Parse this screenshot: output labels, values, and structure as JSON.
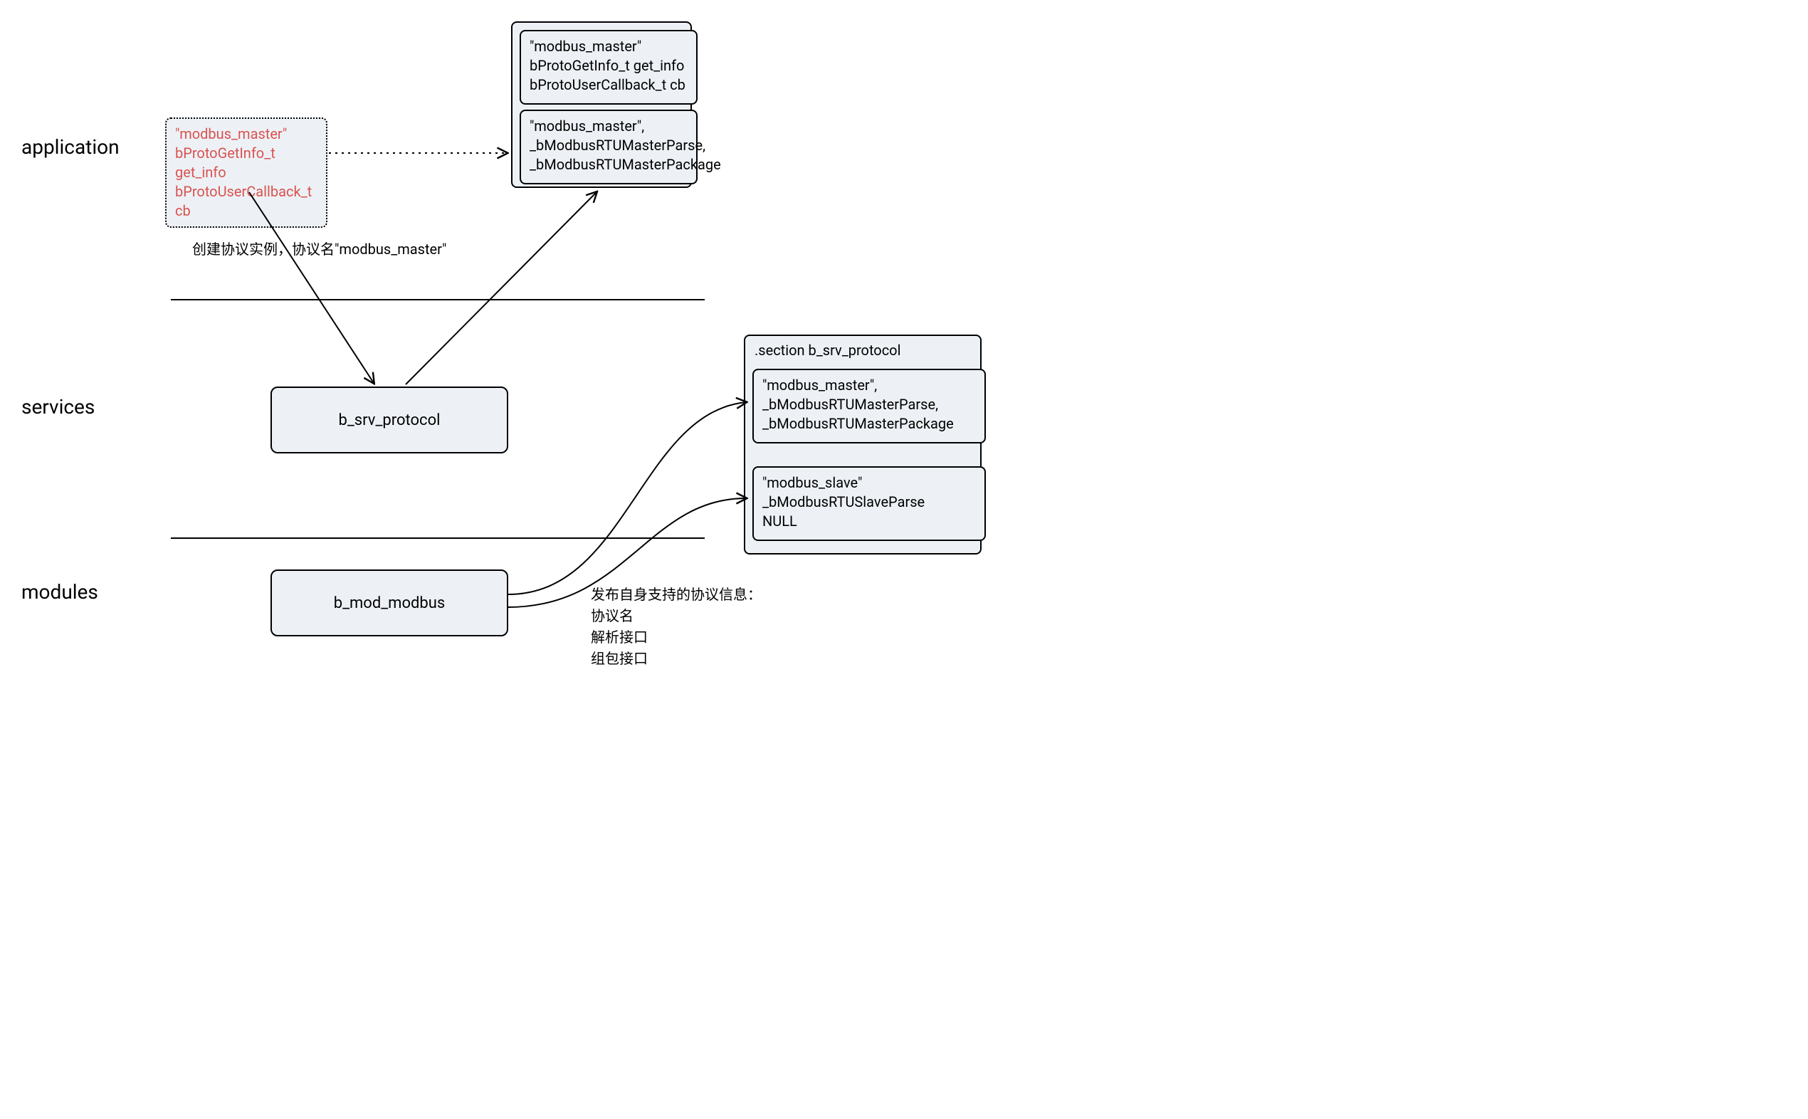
{
  "layers": {
    "application": "application",
    "services": "services",
    "modules": "modules"
  },
  "boxes": {
    "srv": "b_srv_protocol",
    "modbus": "b_mod_modbus"
  },
  "dashedBox": {
    "l1": "\"modbus_master\"",
    "l2": "bProtoGetInfo_t get_info",
    "l3": "bProtoUserCallback_t cb"
  },
  "topPanel": {
    "inner1": {
      "l1": "\"modbus_master\"",
      "l2": "bProtoGetInfo_t get_info",
      "l3": "bProtoUserCallback_t cb"
    },
    "inner2": {
      "l1": "\"modbus_master\",",
      "l2": "_bModbusRTUMasterParse,",
      "l3": "_bModbusRTUMasterPackage"
    }
  },
  "rightPanel": {
    "title": ".section b_srv_protocol",
    "inner1": {
      "l1": "\"modbus_master\",",
      "l2": "_bModbusRTUMasterParse,",
      "l3": "_bModbusRTUMasterPackage"
    },
    "inner2": {
      "l1": "\"modbus_slave\"",
      "l2": "_bModbusRTUSlaveParse",
      "l3": "NULL"
    }
  },
  "notes": {
    "create": "创建协议实例，协议名\"modbus_master\"",
    "publish": "发布自身支持的协议信息：\n协议名\n解析接口\n组包接口"
  }
}
